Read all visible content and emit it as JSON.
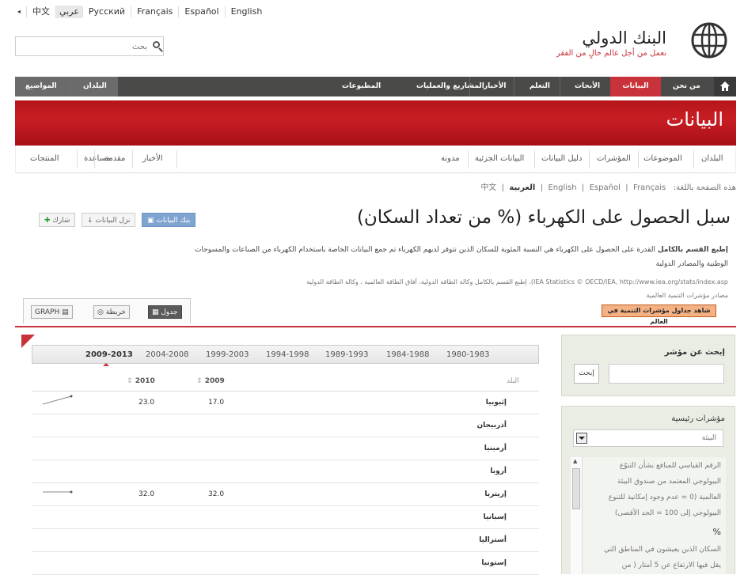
{
  "languages": [
    "English",
    "Español",
    "Français",
    "Русский",
    "عربي",
    "中文"
  ],
  "search": {
    "placeholder": "بحث"
  },
  "logo": {
    "name": "البنك الدولي",
    "tagline": "نعمل من أجل عالم خالٍ من الفقر"
  },
  "nav": {
    "items": [
      "من نحن",
      "البيانات",
      "الأبحاث",
      "التعلم",
      "الأخبار",
      "المشاريع والعمليات",
      "المطبوعات"
    ],
    "active": "البيانات",
    "left_items": [
      "البلدان",
      "المواضيع"
    ]
  },
  "banner": {
    "title": "البيانات"
  },
  "subnav": {
    "right": [
      "البلدان",
      "الموضوعات",
      "المؤشرات",
      "دليل البيانات",
      "البيانات الجزئية",
      "مدونة"
    ],
    "left": [
      "الأخبار",
      "مقدمة",
      "مساعدة",
      "المنتجات"
    ]
  },
  "page_languages": {
    "label": "هذه الصفحة باللغة:",
    "items": [
      "English",
      "Español",
      "Français",
      "العربية",
      "中文"
    ],
    "current": "العربية"
  },
  "page_title": "سبل الحصول على الكهرباء (% من تعداد السكان)",
  "actions": {
    "databank": "بنك البيانات",
    "download": "نزل البيانات",
    "share": "شارك"
  },
  "description": {
    "bold": "إطبع القسم بالكامل",
    "text": "القدرة على الحصول على الكهرباء هي النسبة المئوية للسكان الذين تتوفر لديهم الكهرباء تم جمع البيانات الخاصة باستخدام الكهرباء من الصناعات والمسوحات الوطنية والمصادر الدولية"
  },
  "source": {
    "line1": "IEA Statistics © OECD/IEA, http://www.iea.org/stats/index.asp)، إطبع القسم بالكامل وكالة الطاقة الدولية، آفاق الطاقة العالمية ، وكالة الطاقة الدولية",
    "line2": "مصادر مؤشرات التنمية العالمية"
  },
  "wdi_button": "شاهد جداول مؤشرات التنمية في العالم",
  "view_tabs": {
    "table": "جدول",
    "map": "خريطة",
    "graph": "GRAPH"
  },
  "periods": [
    "1980-1983",
    "1984-1988",
    "1989-1993",
    "1994-1998",
    "1999-2003",
    "2004-2008",
    "2009-2013"
  ],
  "active_period": "2009-2013",
  "table": {
    "col_country": "البلد",
    "col_years": [
      "2009",
      "2010"
    ],
    "rows": [
      {
        "country": "إثيوبيا",
        "v2009": "17.0",
        "v2010": "23.0"
      },
      {
        "country": "أذربيجان",
        "v2009": "",
        "v2010": ""
      },
      {
        "country": "أرمينيا",
        "v2009": "",
        "v2010": ""
      },
      {
        "country": "أروبا",
        "v2009": "",
        "v2010": ""
      },
      {
        "country": "إريتريا",
        "v2009": "32.0",
        "v2010": "32.0"
      },
      {
        "country": "إسبانيا",
        "v2009": "",
        "v2010": ""
      },
      {
        "country": "أستراليا",
        "v2009": "",
        "v2010": ""
      },
      {
        "country": "إستونيا",
        "v2009": "",
        "v2010": ""
      }
    ]
  },
  "sidebar": {
    "search_title": "إبحث عن مؤشر",
    "search_button": "إبحث",
    "key_title": "مؤشرات رئيسية",
    "topic_selected": "البيئة",
    "list": [
      "الرقم القياسي للمنافع بشأن التنوّع",
      "البيولوجي المعتمد من صندوق البيئة",
      "العالمية (0 = عدم وجود إمكانية للتنوع",
      "البيولوجي إلى 100 = الحد الأقصى)",
      "%",
      "السكان الذين يعيشون في المناطق التي",
      "يقل فيها الارتفاع عن 5 أمتار ( من"
    ]
  }
}
